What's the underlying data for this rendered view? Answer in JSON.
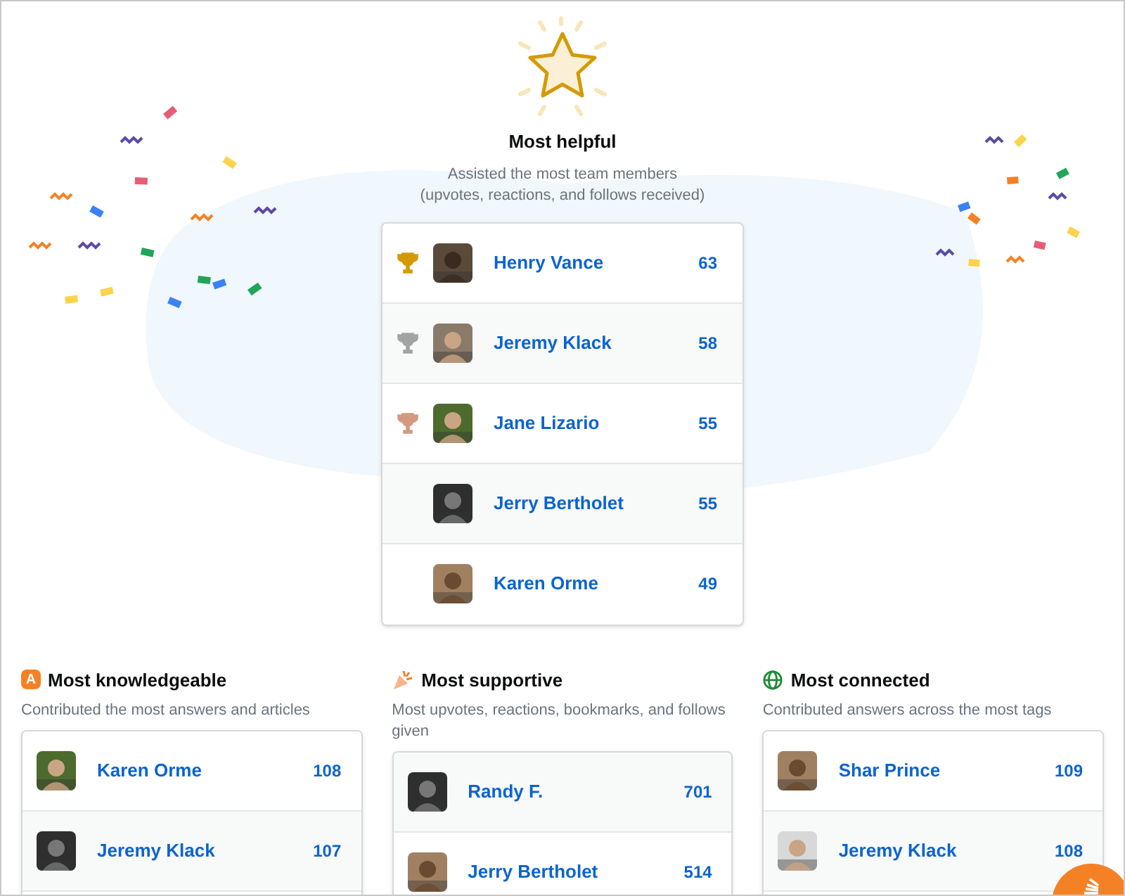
{
  "featured": {
    "title": "Most helpful",
    "description": [
      "Assisted the most team members",
      "(upvotes, reactions, and follows received)"
    ],
    "rows": [
      {
        "name": "Henry Vance",
        "count": "63",
        "trophy": {
          "color": "#d49a05"
        }
      },
      {
        "name": "Jeremy Klack",
        "count": "58",
        "trophy": {
          "color": "#a3a3a3"
        }
      },
      {
        "name": "Jane Lizario",
        "count": "55",
        "trophy": {
          "color": "#d39a80"
        }
      },
      {
        "name": "Jerry Bertholet",
        "count": "55"
      },
      {
        "name": "Karen Orme",
        "count": "49"
      }
    ]
  },
  "categories": [
    {
      "kind": "knowledge",
      "icon_text": "A",
      "title": "Most knowledgeable",
      "description": "Contributed the most answers and articles",
      "rows": [
        {
          "name": "Karen Orme",
          "count": "108"
        },
        {
          "name": "Jeremy Klack",
          "count": "107"
        }
      ]
    },
    {
      "kind": "support",
      "title": "Most supportive",
      "description": "Most upvotes, reactions, bookmarks, and follows given",
      "rows": [
        {
          "name": "Randy F.",
          "count": "701"
        },
        {
          "name": "Jerry Bertholet",
          "count": "514"
        }
      ]
    },
    {
      "kind": "connected",
      "title": "Most connected",
      "description": "Contributed answers across the most tags",
      "rows": [
        {
          "name": "Shar Prince",
          "count": "109"
        },
        {
          "name": "Jeremy Klack",
          "count": "108"
        }
      ]
    }
  ]
}
